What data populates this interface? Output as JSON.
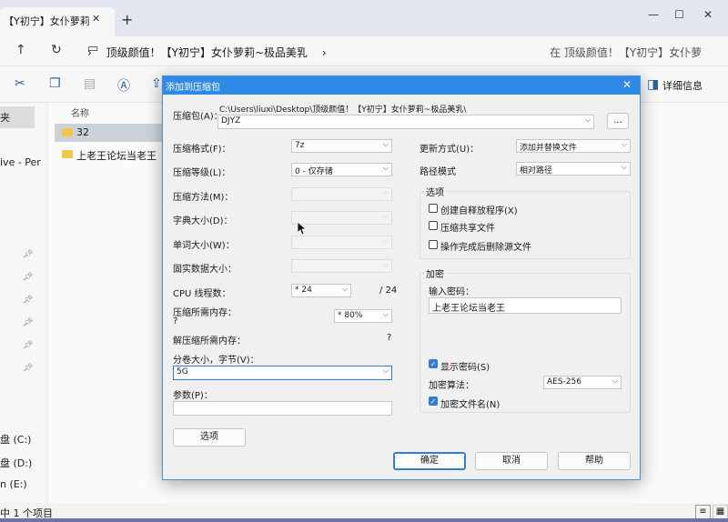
{
  "explorer": {
    "tab_title": "【Y初宁】女仆萝莉",
    "address": "顶级颜值！【Y初宁】女仆萝莉~极品美乳",
    "search_placeholder": "在 顶级颜值！【Y初宁】女仆萝",
    "details_label": "详细信息",
    "column_name": "名称",
    "files": [
      {
        "name": "32"
      },
      {
        "name": "上老王论坛当老王"
      }
    ],
    "sidebar": {
      "item_1": "夹",
      "item_2": "ive - Per",
      "drive_c": "盘 (C:)",
      "drive_d": "盘 (D:)",
      "drive_e": "n (E:)"
    },
    "status": "中 1 个项目"
  },
  "dialog": {
    "title": "添加到压缩包",
    "archive_label": "压缩包(A)：",
    "archive_path": "C:\\Users\\liuxi\\Desktop\\顶级颜值！【Y初宁】女仆萝莉~极品美乳\\",
    "archive_name": "DJYZ",
    "browse_label": "...",
    "format_label": "压缩格式(F)：",
    "format_value": "7z",
    "level_label": "压缩等级(L)：",
    "level_value": "0 - 仅存储",
    "method_label": "压缩方法(M)：",
    "dict_label": "字典大小(D)：",
    "word_label": "单词大小(W)：",
    "solid_label": "固实数据大小：",
    "cpu_label": "CPU 线程数：",
    "cpu_value": "* 24",
    "cpu_total": "/ 24",
    "mem_comp_label": "压缩所需内存：",
    "mem_comp_sub": "?",
    "mem_comp_value": "* 80%",
    "mem_decomp_label": "解压缩所需内存：",
    "mem_decomp_value": "?",
    "volume_label": "分卷大小，字节(V)：",
    "volume_value": "5G",
    "params_label": "参数(P)：",
    "options_button": "选项",
    "update_label": "更新方式(U)：",
    "update_value": "添加并替换文件",
    "path_label": "路径模式",
    "path_value": "相对路径",
    "options_group": "选项",
    "opt_sfx": "创建自释放程序(X)",
    "opt_shared": "压缩共享文件",
    "opt_delete": "操作完成后删除源文件",
    "encrypt_group": "加密",
    "password_label": "输入密码：",
    "password_value": "上老王论坛当老王",
    "show_password": "显示密码(S)",
    "enc_method_label": "加密算法：",
    "enc_method_value": "AES-256",
    "encrypt_names": "加密文件名(N)",
    "ok_button": "确定",
    "cancel_button": "取消",
    "help_button": "帮助"
  }
}
